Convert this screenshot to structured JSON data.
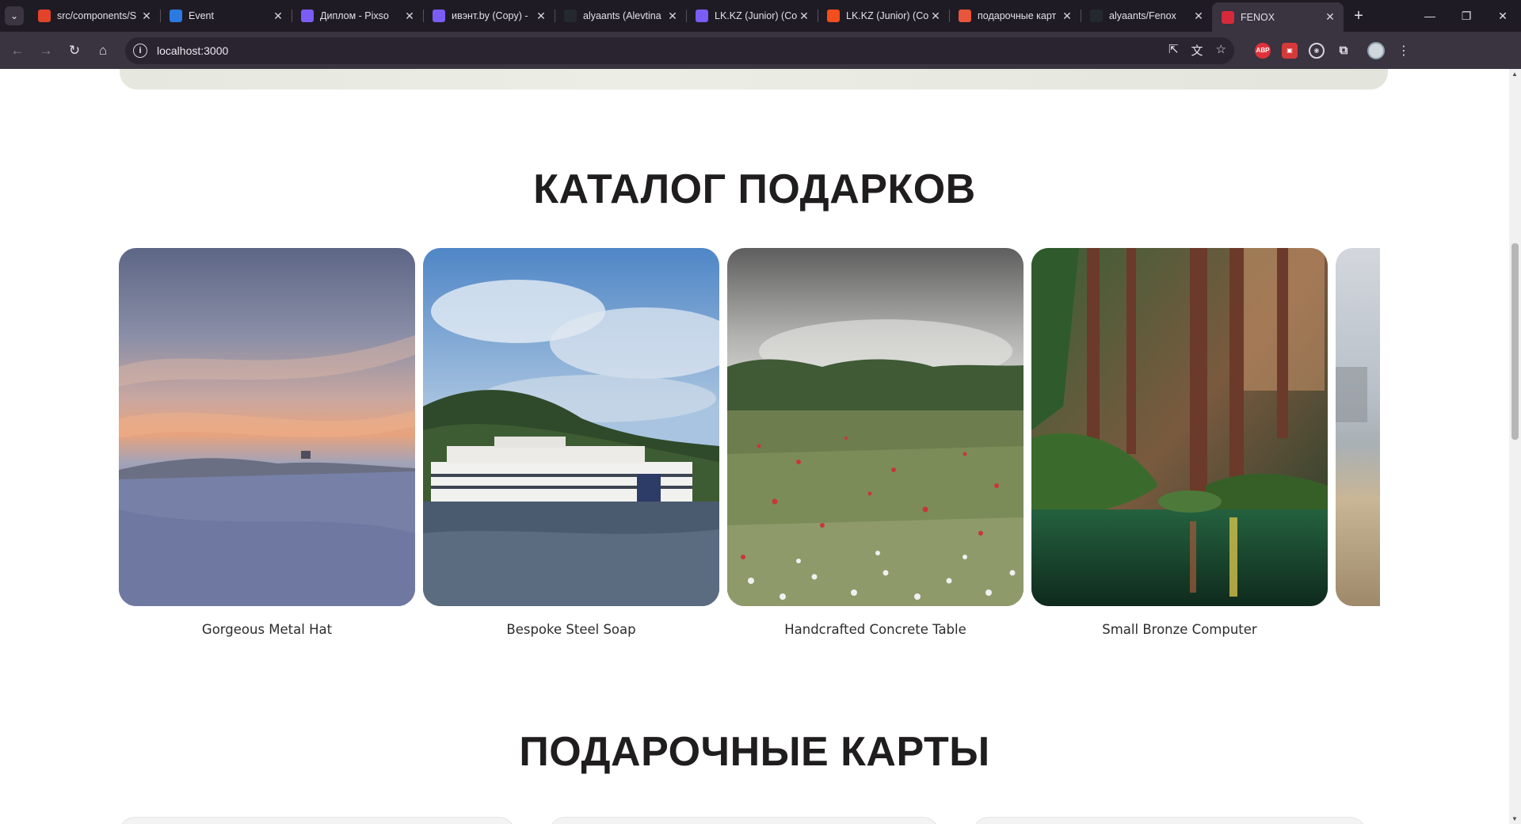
{
  "browser": {
    "tabs": [
      {
        "title": "src/components/S",
        "favicon": "gitlab-icon",
        "color": "#e24329"
      },
      {
        "title": "Event",
        "favicon": "page-icon",
        "color": "#2a7ae2"
      },
      {
        "title": "Диплом - Pixso",
        "favicon": "pixso-icon",
        "color": "#7b5cf5"
      },
      {
        "title": "ивэнт.by (Copy) -",
        "favicon": "pixso-icon",
        "color": "#7b5cf5"
      },
      {
        "title": "alyaants (Alevtina",
        "favicon": "github-icon",
        "color": "#24292f"
      },
      {
        "title": "LK.KZ (Junior) (Co",
        "favicon": "pixso-icon",
        "color": "#7b5cf5"
      },
      {
        "title": "LK.KZ (Junior) (Co",
        "favicon": "figma-icon",
        "color": "#f24e1e"
      },
      {
        "title": "подарочные карт",
        "favicon": "app-icon",
        "color": "#e8553b"
      },
      {
        "title": "alyaants/Fenox",
        "favicon": "github-icon",
        "color": "#24292f"
      },
      {
        "title": "FENOX",
        "favicon": "fenox-icon",
        "color": "#d62a3a",
        "active": true
      }
    ],
    "url": "localhost:3000"
  },
  "page": {
    "catalog_title": "КАТАЛОГ ПОДАРКОВ",
    "gift_cards_title": "ПОДАРОЧНЫЕ КАРТЫ",
    "products": [
      {
        "name": "Gorgeous Metal Hat",
        "image": "sunset-dunes-photo"
      },
      {
        "name": "Bespoke Steel Soap",
        "image": "river-ship-photo"
      },
      {
        "name": "Handcrafted Concrete Table",
        "image": "poppy-meadow-photo"
      },
      {
        "name": "Small Bronze Computer",
        "image": "forest-stream-photo"
      },
      {
        "name": "",
        "image": "beach-photo"
      }
    ]
  }
}
